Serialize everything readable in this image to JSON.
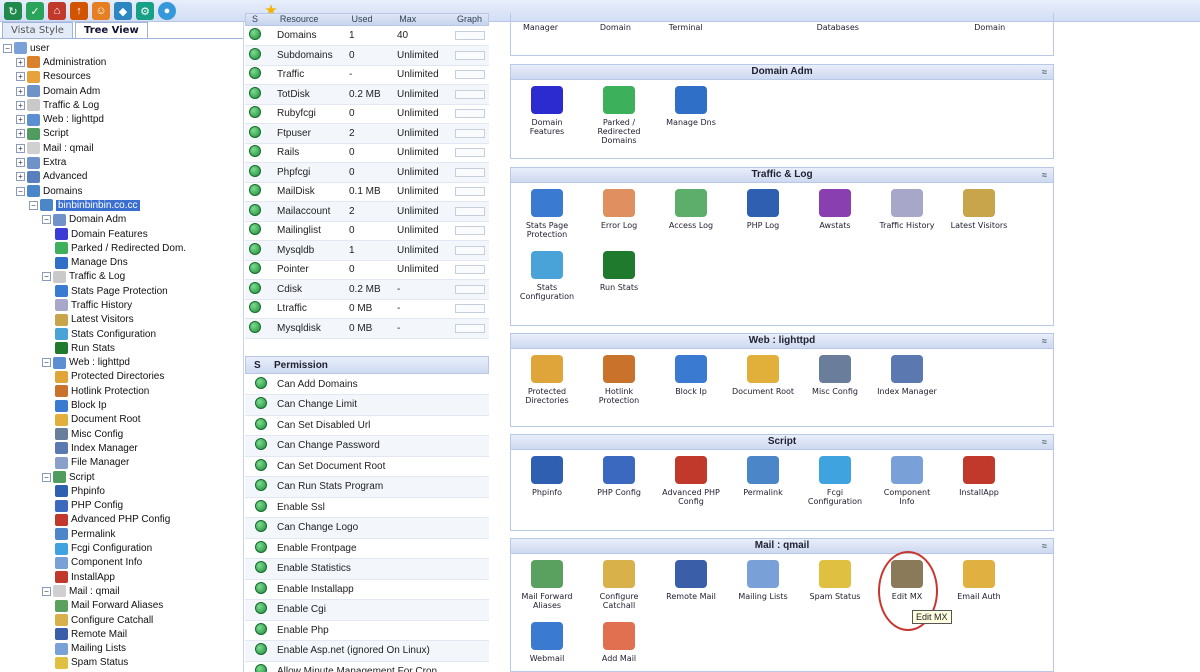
{
  "toolbar": {
    "icons": [
      "refresh-icon",
      "check-icon",
      "home-icon",
      "upload-icon",
      "users-icon",
      "shield-icon",
      "gear-icon",
      "globe-icon"
    ],
    "star_icon": "star-icon"
  },
  "sidebar": {
    "tabs": [
      "Vista Style",
      "Tree View"
    ],
    "tree": [
      {
        "label": "user",
        "depth": 0,
        "toggle": "−",
        "color": "#7aa0d8"
      },
      {
        "label": "Administration",
        "depth": 1,
        "toggle": "+",
        "color": "#d9822b"
      },
      {
        "label": "Resources",
        "depth": 1,
        "toggle": "+",
        "color": "#e7a33b"
      },
      {
        "label": "Domain Adm",
        "depth": 1,
        "toggle": "+",
        "color": "#6f93c8"
      },
      {
        "label": "Traffic & Log",
        "depth": 1,
        "toggle": "+",
        "color": "#c9c9c9"
      },
      {
        "label": "Web : lighttpd",
        "depth": 1,
        "toggle": "+",
        "color": "#5b8fd1"
      },
      {
        "label": "Script",
        "depth": 1,
        "toggle": "+",
        "color": "#4f9c5e"
      },
      {
        "label": "Mail : qmail",
        "depth": 1,
        "toggle": "+",
        "color": "#d0d0d0"
      },
      {
        "label": "Extra",
        "depth": 1,
        "toggle": "+",
        "color": "#6f93c8"
      },
      {
        "label": "Advanced",
        "depth": 1,
        "toggle": "+",
        "color": "#5a7fbf"
      },
      {
        "label": "Domains",
        "depth": 1,
        "toggle": "−",
        "color": "#4a86c8"
      },
      {
        "label": "binbinbinbin.co.cc",
        "depth": 2,
        "toggle": "−",
        "color": "#4a86c8",
        "selected": true
      },
      {
        "label": "Domain Adm",
        "depth": 3,
        "toggle": "−",
        "color": "#6f93c8"
      },
      {
        "label": "Domain Features",
        "depth": 4,
        "toggle": "",
        "color": "#3b3bd6"
      },
      {
        "label": "Parked / Redirected Dom.",
        "depth": 4,
        "toggle": "",
        "color": "#3cb05a"
      },
      {
        "label": "Manage Dns",
        "depth": 4,
        "toggle": "",
        "color": "#2f6fc7"
      },
      {
        "label": "Traffic & Log",
        "depth": 3,
        "toggle": "−",
        "color": "#c9c9c9"
      },
      {
        "label": "Stats Page Protection",
        "depth": 4,
        "toggle": "",
        "color": "#3a7ad0"
      },
      {
        "label": "Traffic History",
        "depth": 4,
        "toggle": "",
        "color": "#a7a7c9"
      },
      {
        "label": "Latest Visitors",
        "depth": 4,
        "toggle": "",
        "color": "#c8a54a"
      },
      {
        "label": "Stats Configuration",
        "depth": 4,
        "toggle": "",
        "color": "#4aa3d8"
      },
      {
        "label": "Run Stats",
        "depth": 4,
        "toggle": "",
        "color": "#1f7a2e"
      },
      {
        "label": "Web : lighttpd",
        "depth": 3,
        "toggle": "−",
        "color": "#5b8fd1"
      },
      {
        "label": "Protected Directories",
        "depth": 4,
        "toggle": "",
        "color": "#e0a53a"
      },
      {
        "label": "Hotlink Protection",
        "depth": 4,
        "toggle": "",
        "color": "#c9722b"
      },
      {
        "label": "Block Ip",
        "depth": 4,
        "toggle": "",
        "color": "#3a7ad0"
      },
      {
        "label": "Document Root",
        "depth": 4,
        "toggle": "",
        "color": "#e0b03a"
      },
      {
        "label": "Misc Config",
        "depth": 4,
        "toggle": "",
        "color": "#6a7d9a"
      },
      {
        "label": "Index Manager",
        "depth": 4,
        "toggle": "",
        "color": "#5c78b0"
      },
      {
        "label": "File Manager",
        "depth": 4,
        "toggle": "",
        "color": "#8aa0c8"
      },
      {
        "label": "Script",
        "depth": 3,
        "toggle": "−",
        "color": "#4f9c5e"
      },
      {
        "label": "Phpinfo",
        "depth": 4,
        "toggle": "",
        "color": "#2f5fb0"
      },
      {
        "label": "PHP Config",
        "depth": 4,
        "toggle": "",
        "color": "#3c69c0"
      },
      {
        "label": "Advanced PHP Config",
        "depth": 4,
        "toggle": "",
        "color": "#c0392b"
      },
      {
        "label": "Permalink",
        "depth": 4,
        "toggle": "",
        "color": "#4a86c8"
      },
      {
        "label": "Fcgi Configuration",
        "depth": 4,
        "toggle": "",
        "color": "#3fa3e0"
      },
      {
        "label": "Component Info",
        "depth": 4,
        "toggle": "",
        "color": "#7aa0d8"
      },
      {
        "label": "InstallApp",
        "depth": 4,
        "toggle": "",
        "color": "#c0392b"
      },
      {
        "label": "Mail : qmail",
        "depth": 3,
        "toggle": "−",
        "color": "#d0d0d0"
      },
      {
        "label": "Mail Forward Aliases",
        "depth": 4,
        "toggle": "",
        "color": "#5aa05e"
      },
      {
        "label": "Configure Catchall",
        "depth": 4,
        "toggle": "",
        "color": "#d9b14a"
      },
      {
        "label": "Remote Mail",
        "depth": 4,
        "toggle": "",
        "color": "#3a5fa8"
      },
      {
        "label": "Mailing Lists",
        "depth": 4,
        "toggle": "",
        "color": "#7aa0d8"
      },
      {
        "label": "Spam Status",
        "depth": 4,
        "toggle": "",
        "color": "#e0c040"
      }
    ]
  },
  "resources": {
    "headers": [
      "S",
      "Resource",
      "Used",
      "Max",
      "Graph"
    ],
    "rows": [
      [
        "Domains",
        "1",
        "40"
      ],
      [
        "Subdomains",
        "0",
        "Unlimited"
      ],
      [
        "Traffic",
        "-",
        "Unlimited"
      ],
      [
        "TotDisk",
        "0.2 MB",
        "Unlimited"
      ],
      [
        "Rubyfcgi",
        "0",
        "Unlimited"
      ],
      [
        "Ftpuser",
        "2",
        "Unlimited"
      ],
      [
        "Rails",
        "0",
        "Unlimited"
      ],
      [
        "Phpfcgi",
        "0",
        "Unlimited"
      ],
      [
        "MailDisk",
        "0.1 MB",
        "Unlimited"
      ],
      [
        "Mailaccount",
        "2",
        "Unlimited"
      ],
      [
        "Mailinglist",
        "0",
        "Unlimited"
      ],
      [
        "Mysqldb",
        "1",
        "Unlimited"
      ],
      [
        "Pointer",
        "0",
        "Unlimited"
      ],
      [
        "Cdisk",
        "0.2 MB",
        "-"
      ],
      [
        "Ltraffic",
        "0 MB",
        "-"
      ],
      [
        "Mysqldisk",
        "0 MB",
        "-"
      ]
    ]
  },
  "permissions": {
    "header_s": "S",
    "header": "Permission",
    "rows": [
      "Can Add Domains",
      "Can Change Limit",
      "Can Set Disabled Url",
      "Can Change Password",
      "Can Set Document Root",
      "Can Run Stats Program",
      "Enable Ssl",
      "Can Change Logo",
      "Enable Frontpage",
      "Enable Statistics",
      "Enable Installapp",
      "Enable Cgi",
      "Enable Php",
      "Enable Asp.net (ignored On Linux)",
      "Allow Minute Management For Cron",
      "Allow Scheduler Management"
    ]
  },
  "top_strip": {
    "labels": [
      "Manager",
      "Domain",
      "Terminal",
      "Databases",
      "Domain"
    ]
  },
  "panels": [
    {
      "title": "Domain Adm",
      "collapse": "≈",
      "items": [
        {
          "label": "Domain Features",
          "icon": "domain-features-icon",
          "color": "#2b2bd0"
        },
        {
          "label": "Parked / Redirected Domains",
          "icon": "parked-domains-icon",
          "color": "#3cb05a"
        },
        {
          "label": "Manage Dns",
          "icon": "dns-icon",
          "color": "#2f6fc7"
        }
      ]
    },
    {
      "title": "Traffic & Log",
      "collapse": "≈",
      "items": [
        {
          "label": "Stats Page Protection",
          "icon": "stats-protection-icon",
          "color": "#3a7ad0"
        },
        {
          "label": "Error Log",
          "icon": "error-log-icon",
          "color": "#e09060"
        },
        {
          "label": "Access Log",
          "icon": "access-log-icon",
          "color": "#5cae6a"
        },
        {
          "label": "PHP Log",
          "icon": "php-log-icon",
          "color": "#2f5fb0"
        },
        {
          "label": "Awstats",
          "icon": "awstats-icon",
          "color": "#8a3fb0"
        },
        {
          "label": "Traffic History",
          "icon": "traffic-history-icon",
          "color": "#a7a7c9"
        },
        {
          "label": "Latest Visitors",
          "icon": "latest-visitors-icon",
          "color": "#c8a54a"
        },
        {
          "label": "Stats Configuration",
          "icon": "stats-config-icon",
          "color": "#4aa3d8"
        },
        {
          "label": "Run Stats",
          "icon": "run-stats-icon",
          "color": "#1f7a2e"
        }
      ]
    },
    {
      "title": "Web : lighttpd",
      "collapse": "≈",
      "items": [
        {
          "label": "Protected Directories",
          "icon": "protected-dirs-icon",
          "color": "#e0a53a"
        },
        {
          "label": "Hotlink Protection",
          "icon": "hotlink-icon",
          "color": "#c9722b"
        },
        {
          "label": "Block Ip",
          "icon": "block-ip-icon",
          "color": "#3a7ad0"
        },
        {
          "label": "Document Root",
          "icon": "document-root-icon",
          "color": "#e0b03a"
        },
        {
          "label": "Misc Config",
          "icon": "misc-config-icon",
          "color": "#6a7d9a"
        },
        {
          "label": "Index Manager",
          "icon": "index-manager-icon",
          "color": "#5c78b0"
        }
      ]
    },
    {
      "title": "Script",
      "collapse": "≈",
      "items": [
        {
          "label": "Phpinfo",
          "icon": "phpinfo-icon",
          "color": "#2f5fb0"
        },
        {
          "label": "PHP Config",
          "icon": "php-config-icon",
          "color": "#3c69c0"
        },
        {
          "label": "Advanced PHP Config",
          "icon": "advanced-php-icon",
          "color": "#c0392b"
        },
        {
          "label": "Permalink",
          "icon": "permalink-icon",
          "color": "#4a86c8"
        },
        {
          "label": "Fcgi Configuration",
          "icon": "fcgi-icon",
          "color": "#3fa3e0"
        },
        {
          "label": "Component Info",
          "icon": "component-info-icon",
          "color": "#7aa0d8"
        },
        {
          "label": "InstallApp",
          "icon": "installapp-icon",
          "color": "#c0392b"
        }
      ]
    },
    {
      "title": "Mail : qmail",
      "collapse": "≈",
      "items": [
        {
          "label": "Mail Forward Aliases",
          "icon": "mail-forward-icon",
          "color": "#5aa05e"
        },
        {
          "label": "Configure Catchall",
          "icon": "catchall-icon",
          "color": "#d9b14a"
        },
        {
          "label": "Remote Mail",
          "icon": "remote-mail-icon",
          "color": "#3a5fa8"
        },
        {
          "label": "Mailing Lists",
          "icon": "mailing-lists-icon",
          "color": "#7aa0d8"
        },
        {
          "label": "Spam Status",
          "icon": "spam-status-icon",
          "color": "#e0c040"
        },
        {
          "label": "Edit MX",
          "icon": "edit-mx-icon",
          "color": "#8a7a5a"
        },
        {
          "label": "Email Auth",
          "icon": "email-auth-icon",
          "color": "#e0b040"
        },
        {
          "label": "Webmail",
          "icon": "webmail-icon",
          "color": "#3a7ad0"
        },
        {
          "label": "Add Mail",
          "icon": "add-mail-icon",
          "color": "#e07050"
        }
      ]
    }
  ],
  "tooltip": "Edit MX"
}
